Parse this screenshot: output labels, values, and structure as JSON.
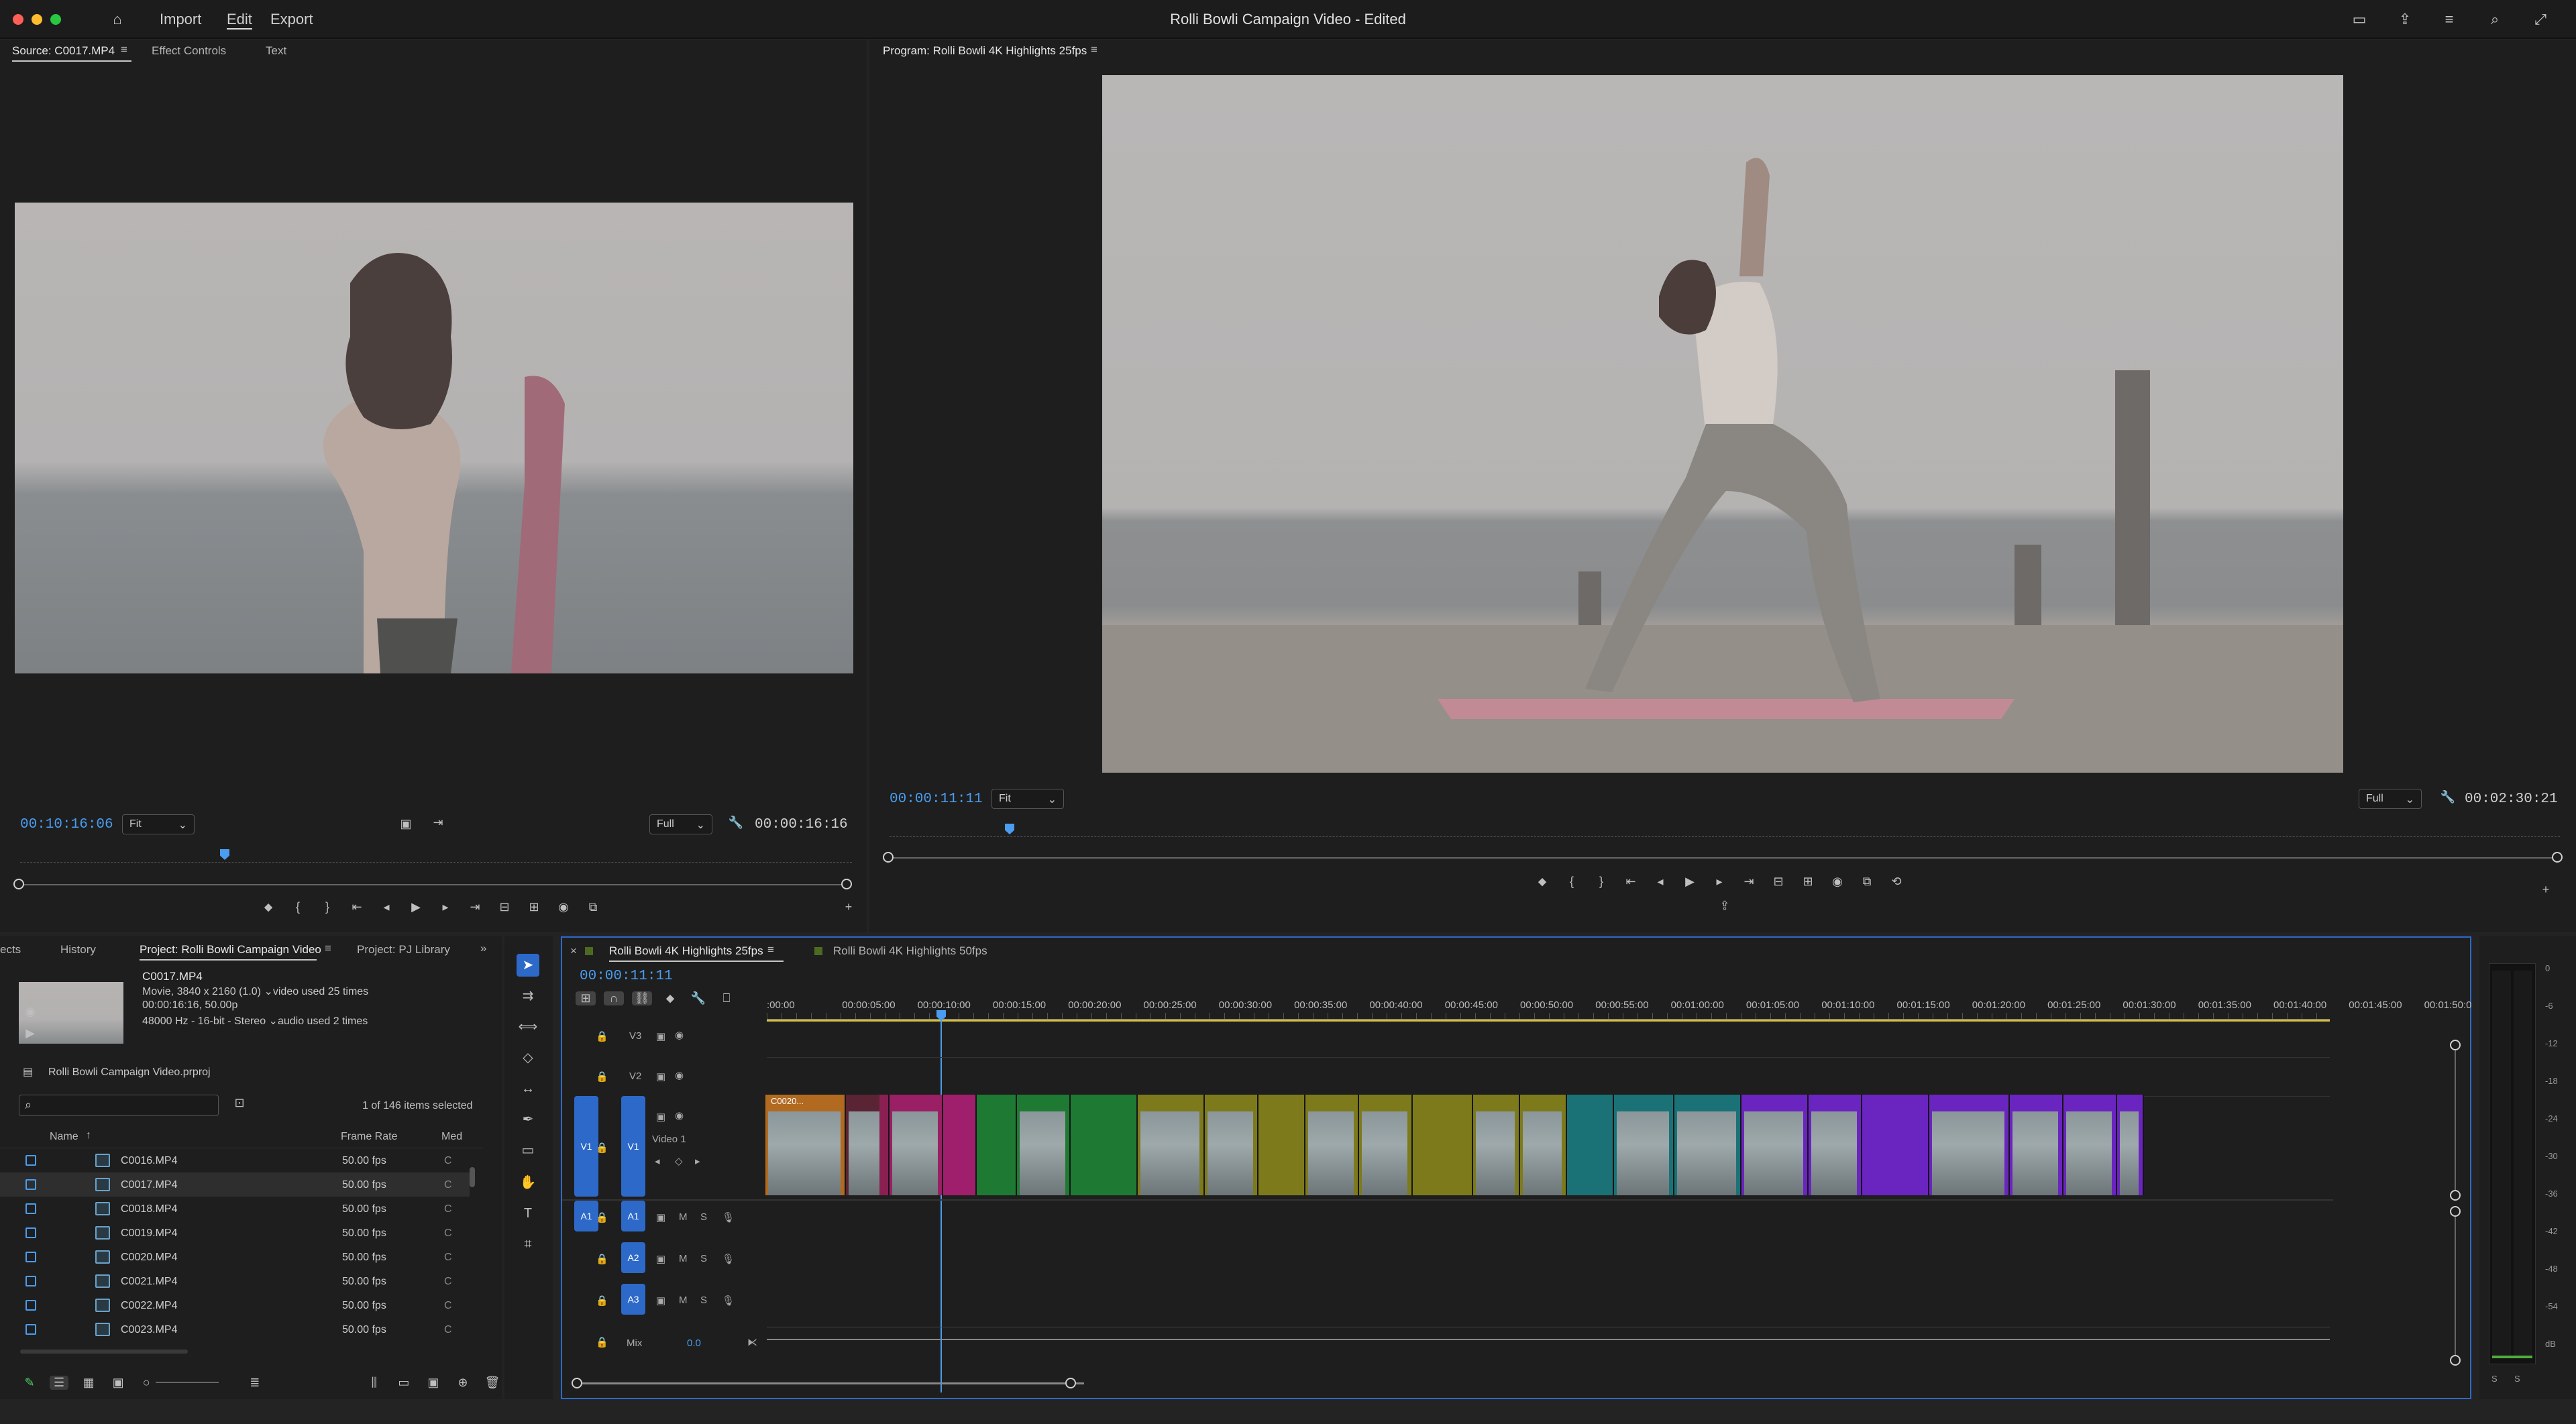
{
  "topbar": {
    "menus": [
      "Import",
      "Edit",
      "Export"
    ],
    "title": "Rolli Bowli Campaign Video",
    "title_suffix": " - Edited"
  },
  "source": {
    "tabs": [
      "Source: C0017.MP4",
      "Effect Controls",
      "Text"
    ],
    "timecode": "00:10:16:06",
    "fit": "Fit",
    "quality": "Full",
    "duration": "00:00:16:16"
  },
  "program": {
    "tab": "Program: Rolli Bowli 4K Highlights 25fps",
    "timecode": "00:00:11:11",
    "fit": "Fit",
    "quality": "Full",
    "duration": "00:02:30:21"
  },
  "project": {
    "tabs": [
      "ects",
      "History",
      "Project: Rolli Bowli Campaign Video",
      "Project: PJ Library"
    ],
    "clip_name": "C0017.MP4",
    "meta1": "Movie, 3840 x 2160 (1.0)",
    "meta1b": "video used 25 times",
    "meta2": "00:00:16:16, 50.00p",
    "meta3": "48000 Hz - 16-bit - Stereo",
    "meta3b": "audio used 2 times",
    "file": "Rolli Bowli Campaign Video.prproj",
    "selected": "1 of 146 items selected",
    "columns": [
      "Name",
      "Frame Rate",
      "Med"
    ],
    "rows": [
      {
        "name": "C0016.MP4",
        "rate": "50.00 fps"
      },
      {
        "name": "C0017.MP4",
        "rate": "50.00 fps"
      },
      {
        "name": "C0018.MP4",
        "rate": "50.00 fps"
      },
      {
        "name": "C0019.MP4",
        "rate": "50.00 fps"
      },
      {
        "name": "C0020.MP4",
        "rate": "50.00 fps"
      },
      {
        "name": "C0021.MP4",
        "rate": "50.00 fps"
      },
      {
        "name": "C0022.MP4",
        "rate": "50.00 fps"
      },
      {
        "name": "C0023.MP4",
        "rate": "50.00 fps"
      }
    ]
  },
  "timeline": {
    "tabs": [
      "Rolli Bowli 4K Highlights 25fps",
      "Rolli Bowli 4K Highlights 50fps"
    ],
    "timecode": "00:00:11:11",
    "ruler": [
      ":00:00",
      "00:00:05:00",
      "00:00:10:00",
      "00:00:15:00",
      "00:00:20:00",
      "00:00:25:00",
      "00:00:30:00",
      "00:00:35:00",
      "00:00:40:00",
      "00:00:45:00",
      "00:00:50:00",
      "00:00:55:00",
      "00:01:00:00",
      "00:01:05:00",
      "00:01:10:00",
      "00:01:15:00",
      "00:01:20:00",
      "00:01:25:00",
      "00:01:30:00",
      "00:01:35:00",
      "00:01:40:00",
      "00:01:45:00",
      "00:01:50:0"
    ],
    "tracks": {
      "v3": "V3",
      "v2": "V2",
      "v1": "V1",
      "v1_name": "Video 1",
      "a1": "A1",
      "a2": "A2",
      "a3": "A3",
      "m": "M",
      "s": "S",
      "mix": "Mix",
      "mix_value": "0.0"
    },
    "first_clip": "C0020..."
  },
  "meter": {
    "scale": [
      "0",
      "-6",
      "-12",
      "-18",
      "-24",
      "-30",
      "-36",
      "-42",
      "-48",
      "-54",
      "dB"
    ],
    "solo": [
      "S",
      "S"
    ]
  }
}
